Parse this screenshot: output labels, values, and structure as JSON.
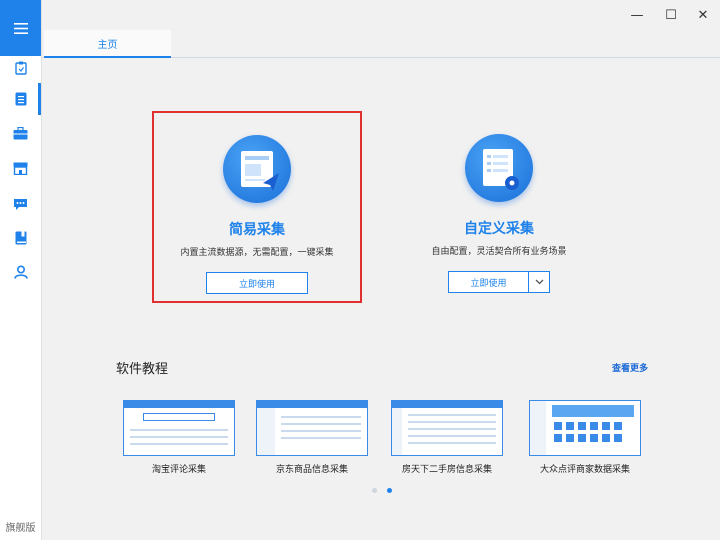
{
  "sidebar": {
    "menu_icon": "hamburger-menu-icon",
    "items": [
      {
        "icon": "clipboard-icon",
        "active": false
      },
      {
        "icon": "document-icon",
        "active": true
      },
      {
        "icon": "briefcase-icon",
        "active": false
      },
      {
        "icon": "store-icon",
        "active": false
      },
      {
        "icon": "chat-icon",
        "active": false
      },
      {
        "icon": "book-icon",
        "active": false
      },
      {
        "icon": "user-icon",
        "active": false
      }
    ],
    "edition": "旗舰版"
  },
  "window_controls": {
    "minimize": "—",
    "maximize": "☐",
    "close": "✕"
  },
  "tabs": [
    {
      "label": "主页"
    }
  ],
  "modes": {
    "simple": {
      "title": "简易采集",
      "desc": "内置主流数据源，无需配置，一键采集",
      "button": "立即使用"
    },
    "custom": {
      "title": "自定义采集",
      "desc": "自由配置，灵活契合所有业务场景",
      "button": "立即使用"
    }
  },
  "tutorials": {
    "title": "软件教程",
    "more": "查看更多",
    "items": [
      {
        "caption": "淘宝评论采集"
      },
      {
        "caption": "京东商品信息采集"
      },
      {
        "caption": "房天下二手房信息采集"
      },
      {
        "caption": "大众点评商家数据采集"
      }
    ],
    "pager": {
      "pages": 2,
      "current": 2
    }
  },
  "colors": {
    "accent": "#1e82ea",
    "selected_border": "#e03030"
  }
}
